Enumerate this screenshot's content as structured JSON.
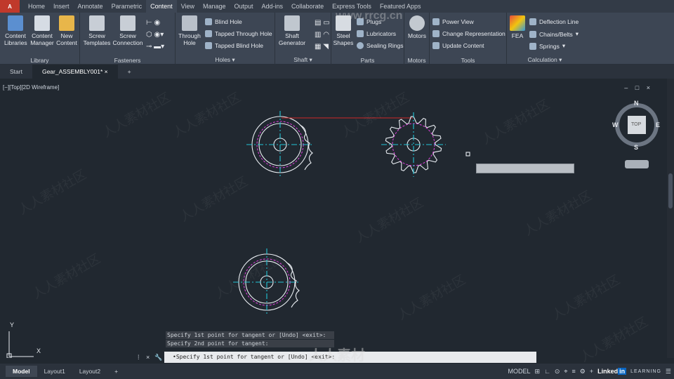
{
  "app": {
    "menu_letter": "A"
  },
  "ribbon_tabs": [
    "Home",
    "Insert",
    "Annotate",
    "Parametric",
    "Content",
    "View",
    "Manage",
    "Output",
    "Add-ins",
    "Collaborate",
    "Express Tools",
    "Featured Apps"
  ],
  "ribbon": {
    "library": {
      "title": "Library",
      "btns": [
        "Content\nLibraries",
        "Content\nManager",
        "New\nContent"
      ]
    },
    "fasteners": {
      "title": "Fasteners",
      "btns": [
        "Screw\nTemplates",
        "Screw\nConnection"
      ]
    },
    "holes": {
      "title": "Holes",
      "big": "Through\nHole",
      "items": [
        "Blind Hole",
        "Tapped Through Hole",
        "Tapped Blind Hole"
      ]
    },
    "shaft": {
      "title": "Shaft",
      "big": "Shaft\nGenerator"
    },
    "parts": {
      "title": "Parts",
      "big": "Steel\nShapes",
      "items": [
        "Plugs",
        "Lubricators",
        "Sealing Rings"
      ]
    },
    "motors": {
      "title": "Motors",
      "big": "Motors"
    },
    "tools": {
      "title": "Tools",
      "items": [
        "Power View",
        "Change Representation",
        "Update Content"
      ]
    },
    "calculation": {
      "title": "Calculation",
      "big": "FEA",
      "items": [
        "Deflection Line",
        "Chains/Belts",
        "Springs"
      ]
    }
  },
  "doc_tabs": [
    "Start",
    "Gear_ASSEMBLY001*"
  ],
  "viewport": {
    "label": "[−][Top][2D Wireframe]",
    "controls": "– □ ×"
  },
  "viewcube": {
    "n": "N",
    "s": "S",
    "e": "E",
    "w": "W",
    "face": "TOP"
  },
  "ucs": {
    "x": "X",
    "y": "Y"
  },
  "command": {
    "history": [
      "Specify 1st point for tangent or [Undo] <exit>:",
      "Specify 2nd point for tangent:"
    ],
    "input": "•Specify 1st point for tangent or [Undo] <exit>:"
  },
  "layouts": [
    "Model",
    "Layout1",
    "Layout2"
  ],
  "status": {
    "model": "MODEL"
  },
  "watermark": {
    "text": "人人素材社区",
    "site": "www.rrcg.cn",
    "brand": "人人素材"
  },
  "branding": {
    "linkedin": "Linked",
    "in": "in",
    "learning": "LEARNING"
  }
}
